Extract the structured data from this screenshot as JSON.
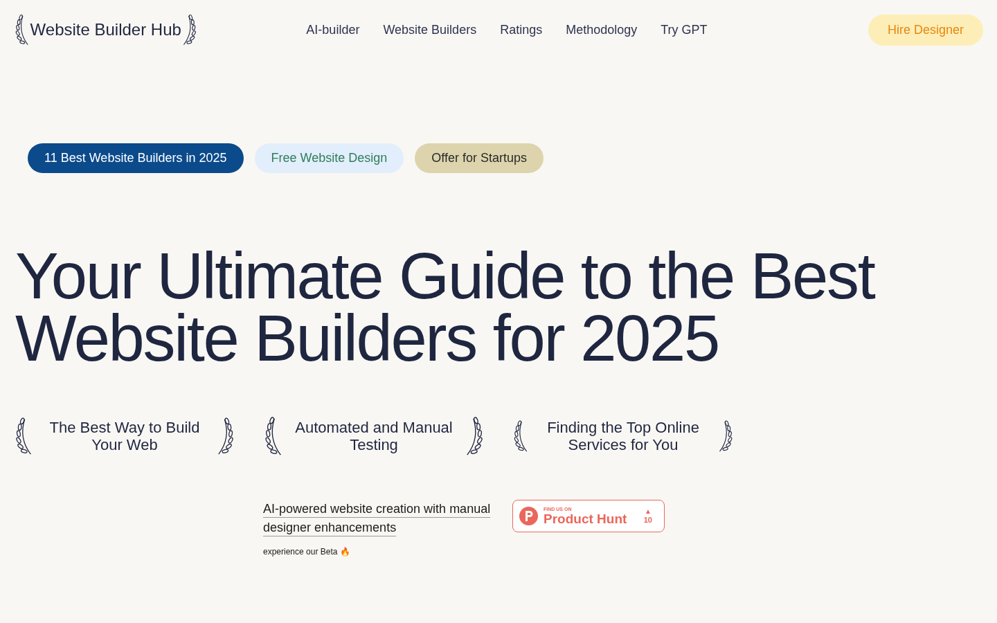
{
  "header": {
    "logo": "Website Builder Hub",
    "nav": [
      "AI-builder",
      "Website Builders",
      "Ratings",
      "Methodology",
      "Try GPT"
    ],
    "cta": "Hire Designer"
  },
  "pills": [
    {
      "label": "11 Best Website Builders in 2025",
      "kind": "primary"
    },
    {
      "label": "Free Website Design",
      "kind": "soft"
    },
    {
      "label": "Offer for Startups",
      "kind": "muted"
    }
  ],
  "headline": "Your Ultimate Guide to the Best Website Builders for 2025",
  "features": [
    "The Best Way to Build Your Web",
    "Automated and Manual Testing",
    "Finding the Top Online Services for You"
  ],
  "promo": {
    "link": "AI-powered website creation with manual designer enhancements",
    "note": "experience our Beta 🔥"
  },
  "badge": {
    "small": "FIND US ON",
    "name": "Product Hunt",
    "arrow": "▲",
    "count": "10"
  }
}
